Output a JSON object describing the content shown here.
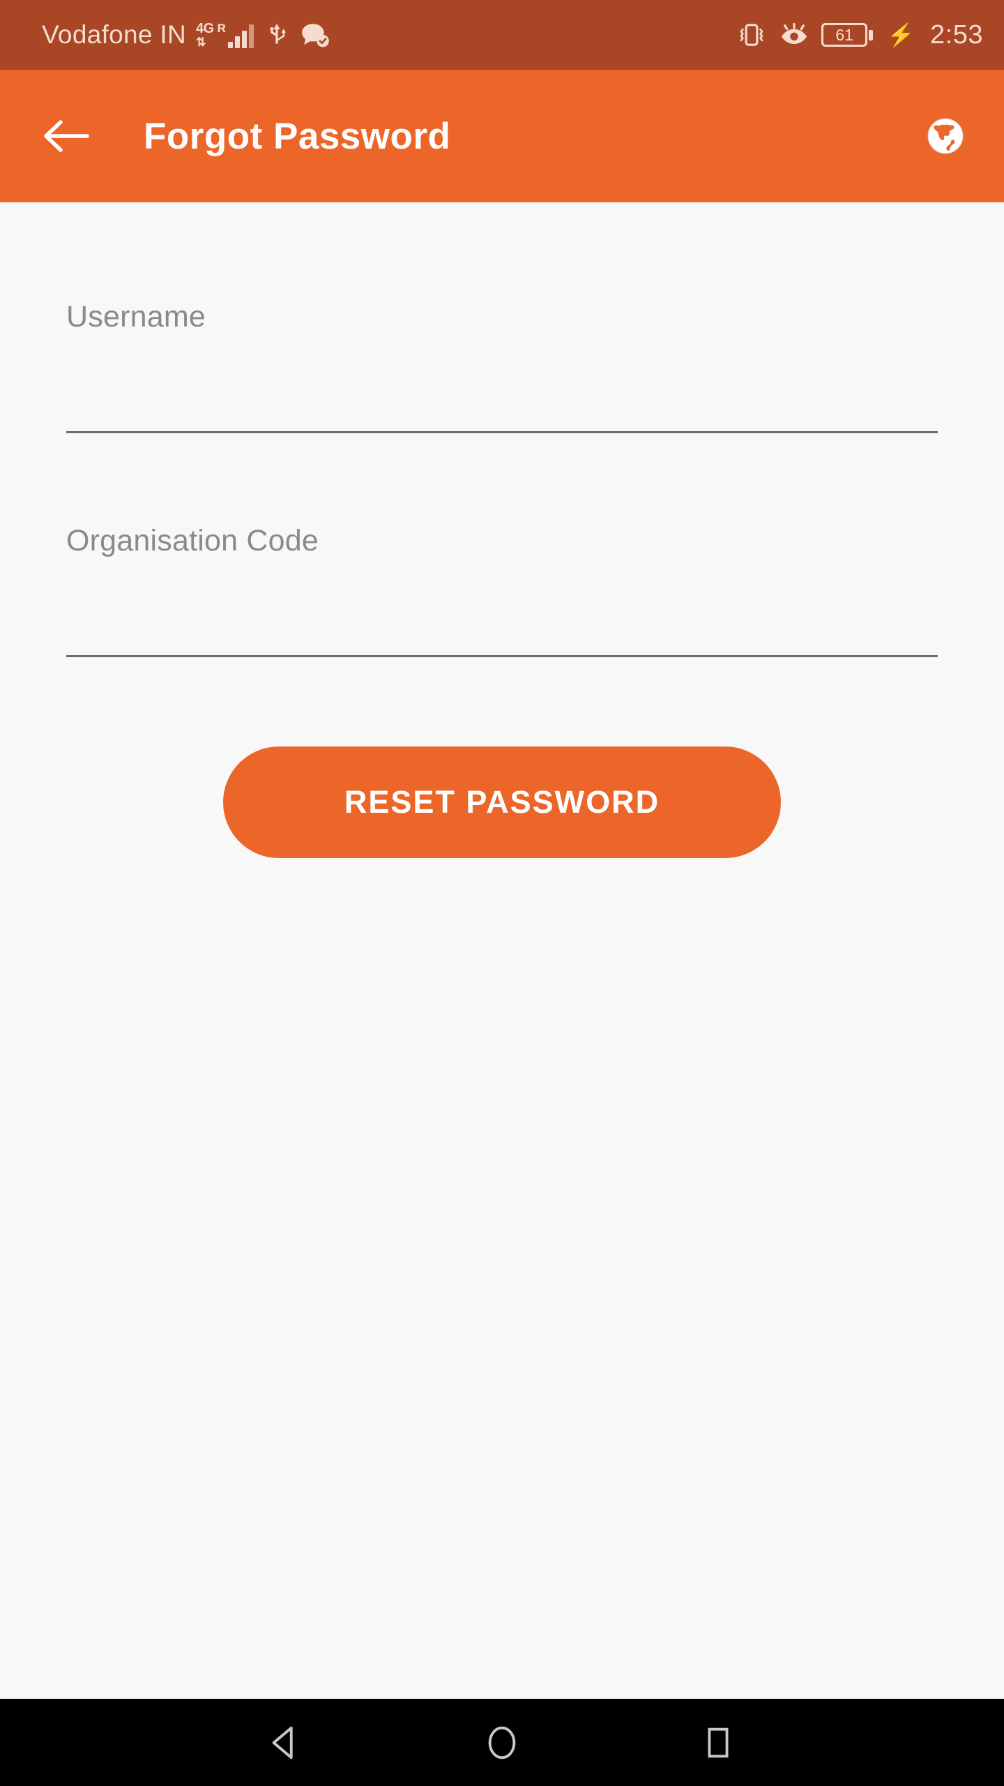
{
  "status_bar": {
    "carrier": "Vodafone IN",
    "network_generation": "4G",
    "network_roaming": "R",
    "network_arrows": "⇅",
    "signal_icon": "signal-bars-icon",
    "usb_icon": "usb-icon",
    "chat_icon": "chat-verified-icon",
    "vibrate_icon": "vibrate-icon",
    "eye_care_icon": "eye-care-icon",
    "battery_level": "61",
    "charging_icon": "charging-bolt-icon",
    "time": "2:53",
    "background_color": "#A84626",
    "foreground_color": "#F6DCCE"
  },
  "app_bar": {
    "back_icon": "back-arrow-icon",
    "title": "Forgot Password",
    "language_icon": "globe-icon",
    "background_color": "#EC6529",
    "title_color": "#FFFFFF"
  },
  "form": {
    "fields": [
      {
        "label": "Username",
        "value": "",
        "placeholder": ""
      },
      {
        "label": "Organisation Code",
        "value": "",
        "placeholder": ""
      }
    ],
    "submit_label": "RESET PASSWORD",
    "submit_color": "#EC6529",
    "label_color": "#8A8A8A",
    "background_color": "#F8F8F8"
  },
  "nav_bar": {
    "back_icon": "nav-back-triangle-icon",
    "home_icon": "nav-home-circle-icon",
    "recents_icon": "nav-recents-square-icon",
    "background_color": "#000000"
  }
}
